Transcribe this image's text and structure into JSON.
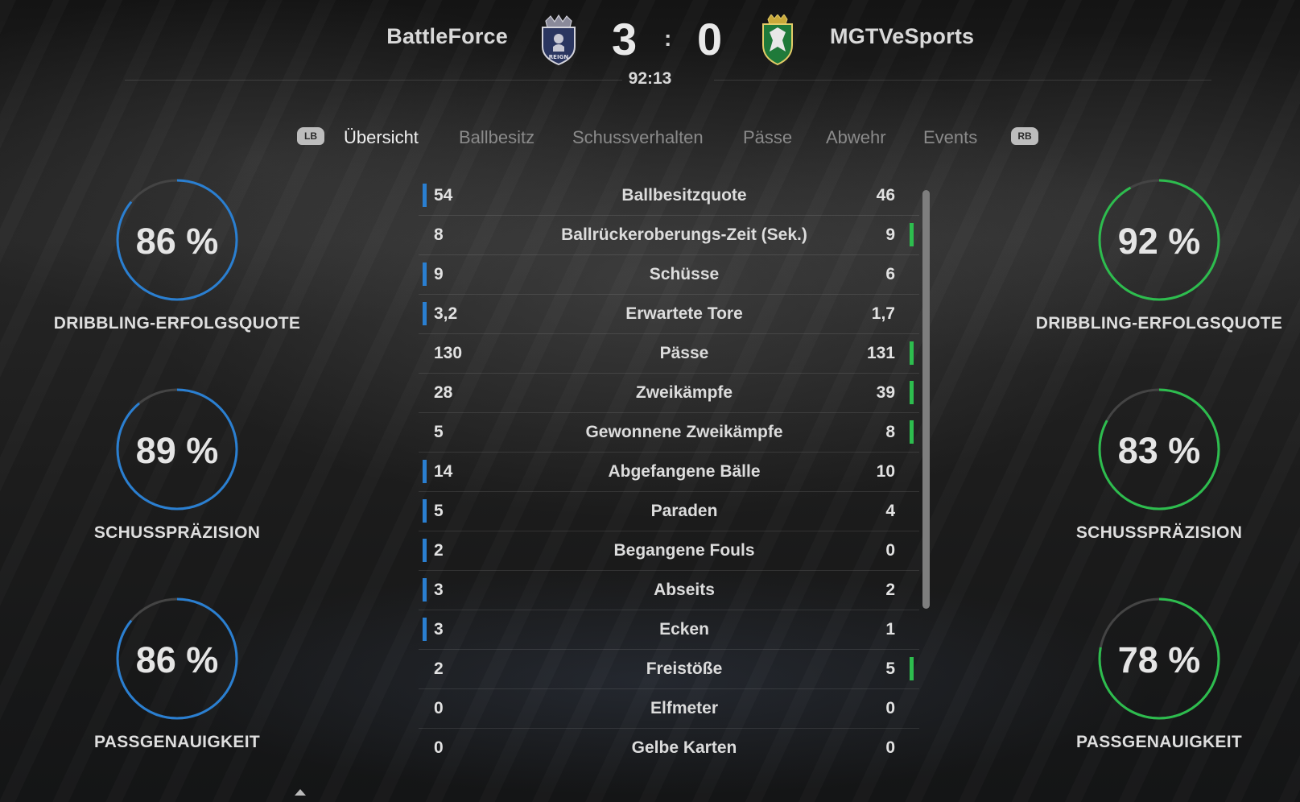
{
  "match": {
    "home_team": "BattleForce",
    "away_team": "MGTVeSports",
    "home_score": "3",
    "separator": ":",
    "away_score": "0",
    "clock": "92:13",
    "home_crest_text": "REIGN"
  },
  "tabs": {
    "lb": "LB",
    "rb": "RB",
    "items": [
      "Übersicht",
      "Ballbesitz",
      "Schussverhalten",
      "Pässe",
      "Abwehr",
      "Events"
    ],
    "active": "Übersicht"
  },
  "colors": {
    "home": "#2a7fd1",
    "away": "#2dbd4e",
    "ring_track": "#444444"
  },
  "home_rings": [
    {
      "value": 86,
      "pct_text": "86 %",
      "label": "DRIBBLING-ERFOLGSQUOTE"
    },
    {
      "value": 89,
      "pct_text": "89 %",
      "label": "SCHUSSPRÄZISION"
    },
    {
      "value": 86,
      "pct_text": "86 %",
      "label": "PASSGENAUIGKEIT"
    }
  ],
  "away_rings": [
    {
      "value": 92,
      "pct_text": "92 %",
      "label": "DRIBBLING-ERFOLGSQUOTE"
    },
    {
      "value": 83,
      "pct_text": "83 %",
      "label": "SCHUSSPRÄZISION"
    },
    {
      "value": 78,
      "pct_text": "78 %",
      "label": "PASSGENAUIGKEIT"
    }
  ],
  "stats": [
    {
      "label": "Ballbesitzquote",
      "home": "54",
      "away": "46",
      "leader": "home"
    },
    {
      "label": "Ballrückeroberungs-Zeit (Sek.)",
      "home": "8",
      "away": "9",
      "leader": "away"
    },
    {
      "label": "Schüsse",
      "home": "9",
      "away": "6",
      "leader": "home"
    },
    {
      "label": "Erwartete Tore",
      "home": "3,2",
      "away": "1,7",
      "leader": "home"
    },
    {
      "label": "Pässe",
      "home": "130",
      "away": "131",
      "leader": "away"
    },
    {
      "label": "Zweikämpfe",
      "home": "28",
      "away": "39",
      "leader": "away"
    },
    {
      "label": "Gewonnene Zweikämpfe",
      "home": "5",
      "away": "8",
      "leader": "away"
    },
    {
      "label": "Abgefangene Bälle",
      "home": "14",
      "away": "10",
      "leader": "home"
    },
    {
      "label": "Paraden",
      "home": "5",
      "away": "4",
      "leader": "home"
    },
    {
      "label": "Begangene Fouls",
      "home": "2",
      "away": "0",
      "leader": "home"
    },
    {
      "label": "Abseits",
      "home": "3",
      "away": "2",
      "leader": "home"
    },
    {
      "label": "Ecken",
      "home": "3",
      "away": "1",
      "leader": "home"
    },
    {
      "label": "Freistöße",
      "home": "2",
      "away": "5",
      "leader": "away"
    },
    {
      "label": "Elfmeter",
      "home": "0",
      "away": "0",
      "leader": "none"
    },
    {
      "label": "Gelbe Karten",
      "home": "0",
      "away": "0",
      "leader": "none"
    }
  ]
}
